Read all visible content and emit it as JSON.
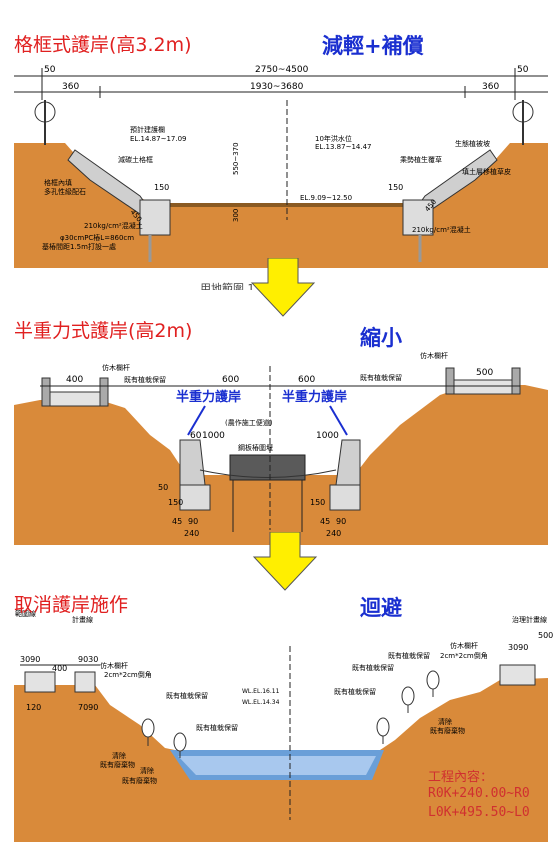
{
  "panels": [
    {
      "title": "格框式護岸(高3.2m)",
      "action": "減輕+補償",
      "dims": {
        "top1": "50",
        "top2": "2750~4500",
        "top3": "50",
        "row2a": "360",
        "row2b": "1930~3680",
        "row2c": "360"
      },
      "labels": {
        "left_water": "預計建護欄",
        "el_left": "EL.14.87~17.09",
        "flood": "10年洪水位",
        "flood_val": "EL.13.87~14.47",
        "bed": "EL.9.09~12.50",
        "left_slope": "減碳土格框",
        "left_fill": "格框內填",
        "left_fill2": "多孔性級配石",
        "pile": "210kg/cm²混凝土",
        "pipe": "φ30cmPC樁L=860cm",
        "pipe2": "基樁間距1.5m打設一處",
        "right_top": "生態植被坡",
        "right_slope": "乘勢植生覆草",
        "right_slope2": "填土層移植草皮",
        "right_pile": "210kg/cm²混凝土",
        "v1": "550~370",
        "v2": "300",
        "d150": "150",
        "d150b": "150",
        "d450": "450",
        "d450b": "450",
        "cut": "用地範圍 13m"
      }
    },
    {
      "title": "半重力式護岸(高2m)",
      "action": "縮小",
      "dims": {
        "d400": "400",
        "d600a": "600",
        "d600b": "600",
        "d500": "500",
        "d1000a": "1000",
        "d1000b": "1000",
        "d240a": "240",
        "d240b": "240",
        "d50": "50",
        "d150a": "150",
        "d150b": "150",
        "d45a": "45",
        "d90a": "90",
        "d45b": "45",
        "d90b": "90",
        "d60": "60"
      },
      "labels": {
        "rail_l": "仿木欄杆",
        "tree_l": "既有植栽保留",
        "rail_r": "仿木欄杆",
        "tree_r": "既有植栽保留",
        "wall_l": "半重力護岸",
        "wall_r": "半重力護岸",
        "mid1": "(農作施工便道)",
        "mid2": "鋼板樁圍堰"
      }
    },
    {
      "title": "取消護岸施作",
      "action": "迴避",
      "dims": {
        "d3090": "3090",
        "d400": "400",
        "d9030": "9030",
        "d120": "120",
        "d7090": "7090",
        "d500": "500",
        "d3090r": "3090"
      },
      "labels": {
        "line_l": "範圍線",
        "line_l2": "計畫線",
        "rail_l": "仿木欄杆",
        "rail_l2": "2cm*2cm倒角",
        "tree1": "既有植栽保留",
        "tree2": "既有植栽保留",
        "rail_r": "仿木欄杆",
        "rail_r2": "2cm*2cm倒角",
        "tree_r1": "既有植栽保留",
        "tree_r2": "既有植栽保留",
        "tree_r3": "既有植栽保留",
        "line_r": "治理計畫線",
        "clear_l": "清除",
        "clear_l2": "既有廢棄物",
        "clear_l3": "清除",
        "clear_l4": "既有廢棄物",
        "clear_r": "清除",
        "clear_r2": "既有廢棄物",
        "wl1": "WL.EL.16.11",
        "wl2": "WL.EL.14.34"
      },
      "work_title": "工程內容：",
      "work_l1": "R0K+240.00~R0",
      "work_l2": "L0K+495.50~L0"
    }
  ],
  "colors": {
    "soil": "#d98a3a",
    "red": "#e02020",
    "blue": "#1a2fd0",
    "arrow": "#ffef00",
    "water": "#6a9fd8"
  }
}
